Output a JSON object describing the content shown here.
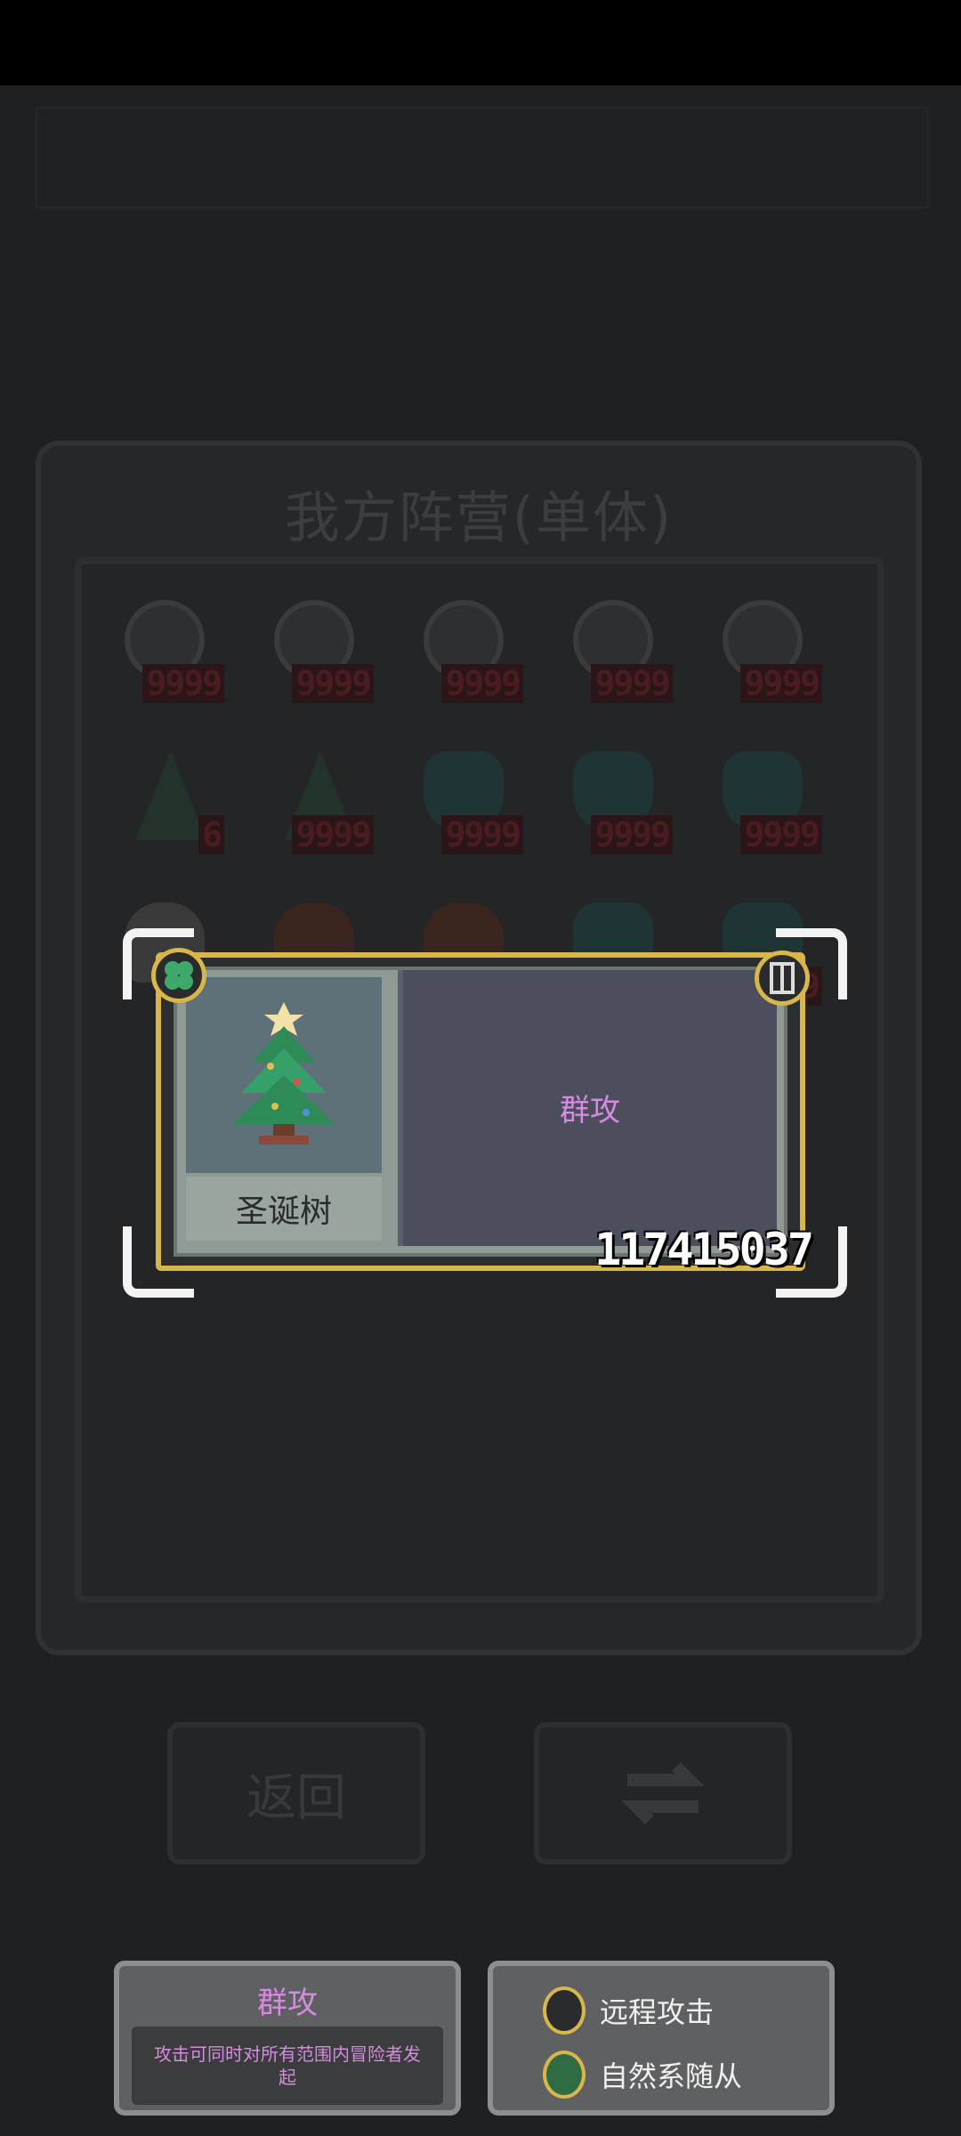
{
  "background": {
    "roster_title": "我方阵营(单体)",
    "units": [
      {
        "kind": "bomb",
        "count": "9999"
      },
      {
        "kind": "bomb",
        "count": "9999"
      },
      {
        "kind": "bomb",
        "count": "9999"
      },
      {
        "kind": "bomb",
        "count": "9999"
      },
      {
        "kind": "bomb",
        "count": "9999"
      },
      {
        "kind": "tree-small",
        "count": "6"
      },
      {
        "kind": "tree-small",
        "count": "9999"
      },
      {
        "kind": "plant",
        "count": "9999"
      },
      {
        "kind": "plant",
        "count": "9999"
      },
      {
        "kind": "plant",
        "count": "9999"
      },
      {
        "kind": "grey",
        "count": ""
      },
      {
        "kind": "brown",
        "count": ""
      },
      {
        "kind": "brown",
        "count": ""
      },
      {
        "kind": "plant",
        "count": ""
      },
      {
        "kind": "plant",
        "count": "9999"
      }
    ],
    "back_button_label": "返回",
    "swap_button_icon": "swap-icon"
  },
  "card": {
    "name": "圣诞树",
    "tag": "群攻",
    "power": "117415037",
    "icon_left": "clover-icon",
    "icon_right": "ranged-attack-icon",
    "portrait_icon": "christmas-tree-icon"
  },
  "info_panel_left": {
    "title": "群攻",
    "description": "攻击可同时对所有范围内冒险者发起"
  },
  "info_panel_right": {
    "traits": [
      {
        "icon": "ranged-attack-icon",
        "label": "远程攻击"
      },
      {
        "icon": "clover-icon",
        "label": "自然系随从"
      }
    ]
  },
  "colors": {
    "accent_gold": "#d8b64a",
    "tag_purple": "#d68ae0",
    "panel_blue": "#4c4e5e"
  }
}
